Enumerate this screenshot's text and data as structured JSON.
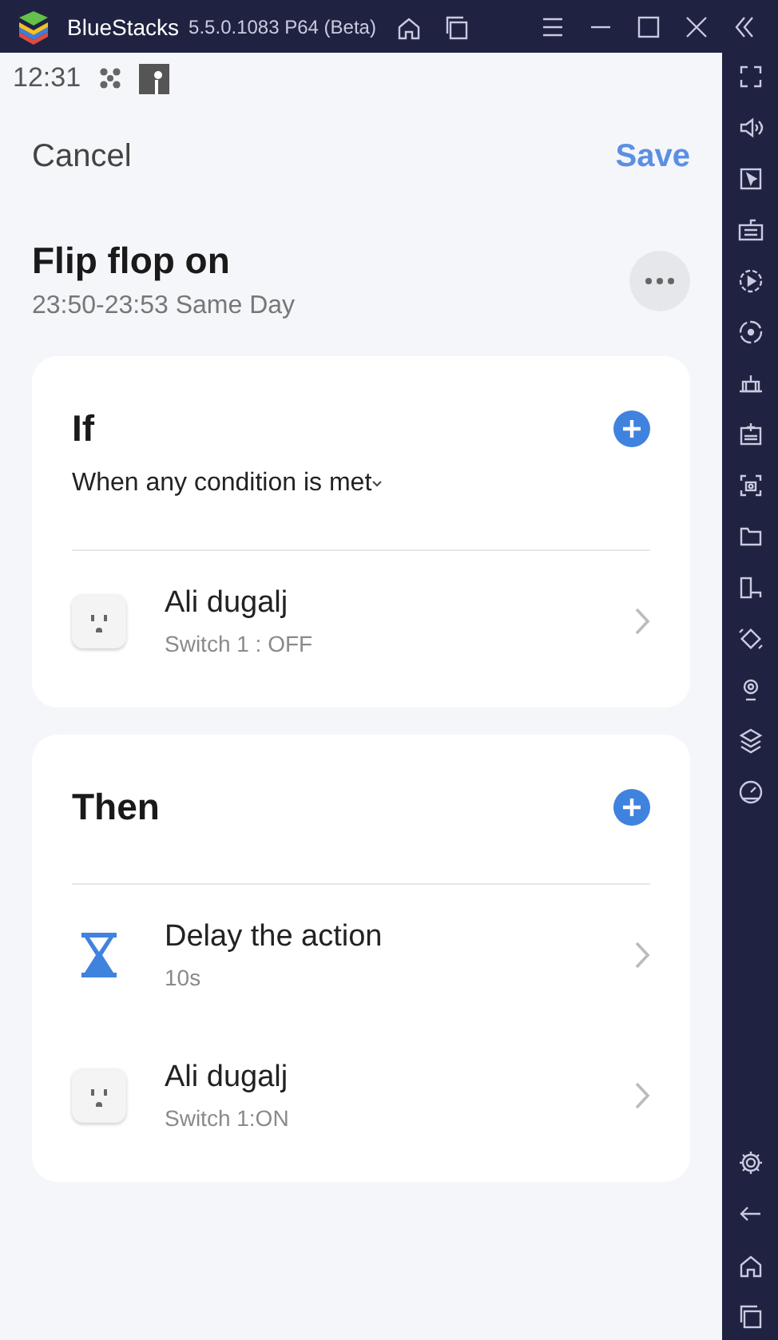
{
  "window": {
    "title": "BlueStacks",
    "version": "5.5.0.1083 P64 (Beta)"
  },
  "status_bar": {
    "time": "12:31"
  },
  "header": {
    "cancel": "Cancel",
    "save": "Save"
  },
  "scene": {
    "title": "Flip flop on",
    "schedule": "23:50-23:53 Same Day"
  },
  "sections": [
    {
      "title": "If",
      "condition": "When any condition is met",
      "items": [
        {
          "kind": "device",
          "name": "Ali dugalj",
          "detail": "Switch 1 : OFF"
        }
      ]
    },
    {
      "title": "Then",
      "items": [
        {
          "kind": "delay",
          "name": "Delay the action",
          "detail": "10s"
        },
        {
          "kind": "device",
          "name": "Ali dugalj",
          "detail": "Switch 1:ON"
        }
      ]
    }
  ]
}
